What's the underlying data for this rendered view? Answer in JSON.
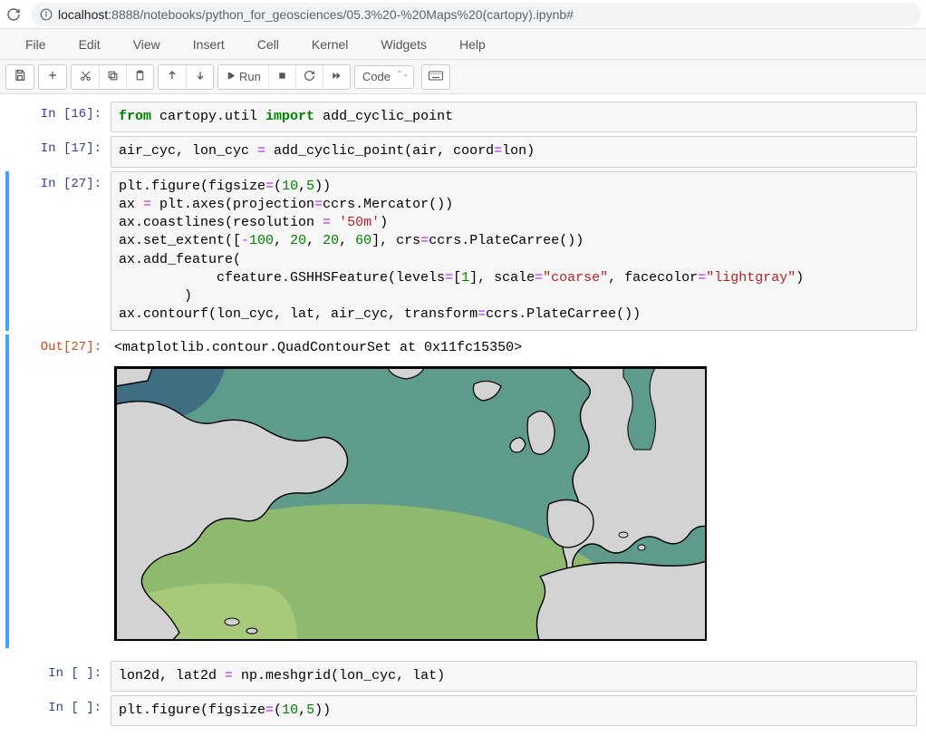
{
  "browser": {
    "url_host": "localhost",
    "url_port": ":8888",
    "url_path": "/notebooks/python_for_geosciences/05.3%20-%20Maps%20(cartopy).ipynb#"
  },
  "menus": [
    "File",
    "Edit",
    "View",
    "Insert",
    "Cell",
    "Kernel",
    "Widgets",
    "Help"
  ],
  "toolbar": {
    "run_label": "Run",
    "celltype": "Code"
  },
  "cells": {
    "c1": {
      "prompt": "In [16]:",
      "code_html": "<span class='kw'>from</span> cartopy.util <span class='kw'>import</span> add_cyclic_point"
    },
    "c2": {
      "prompt": "In [17]:",
      "code_html": "air_cyc, lon_cyc <span class='op'>=</span> add_cyclic_point(air, coord<span class='op'>=</span>lon)"
    },
    "c3": {
      "prompt": "In [27]:",
      "code_html": "plt.figure(figsize<span class='op'>=</span>(<span class='num'>10</span>,<span class='num'>5</span>))\nax <span class='op'>=</span> plt.axes(projection<span class='op'>=</span>ccrs.Mercator())\nax.coastlines(resolution <span class='op'>=</span> <span class='str'>'50m'</span>)\nax.set_extent([<span class='op'>-</span><span class='num'>100</span>, <span class='num'>20</span>, <span class='num'>20</span>, <span class='num'>60</span>], crs<span class='op'>=</span>ccrs.PlateCarree())\nax.add_feature(\n            cfeature.GSHHSFeature(levels<span class='op'>=</span>[<span class='num'>1</span>], scale<span class='op'>=</span><span class='str'>\"coarse\"</span>, facecolor<span class='op'>=</span><span class='str'>\"lightgray\"</span>)\n        )\nax.contourf(lon_cyc, lat, air_cyc, transform<span class='op'>=</span>ccrs.PlateCarree())",
      "out_prompt": "Out[27]:",
      "out_text": "<matplotlib.contour.QuadContourSet at 0x11fc15350>"
    },
    "c4": {
      "prompt": "In [ ]:",
      "code_html": "lon2d, lat2d <span class='op'>=</span> np.meshgrid(lon_cyc, lat)"
    },
    "c5": {
      "prompt": "In [ ]:",
      "code_html": "plt.figure(figsize<span class='op'>=</span>(<span class='num'>10</span>,<span class='num'>5</span>))"
    }
  }
}
